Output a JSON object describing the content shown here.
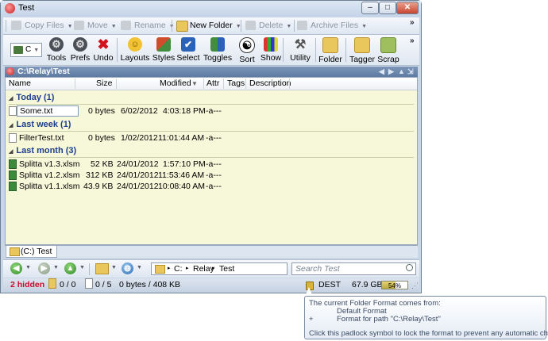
{
  "window": {
    "title": "Test"
  },
  "toolbar1": {
    "copy_files": "Copy Files",
    "move": "Move",
    "rename": "Rename",
    "new_folder": "New Folder",
    "delete": "Delete",
    "archive_files": "Archive Files",
    "overflow": "»"
  },
  "toolbar2": {
    "drive": "C",
    "tools": "Tools",
    "prefs": "Prefs",
    "undo": "Undo",
    "layouts": "Layouts",
    "styles": "Styles",
    "select": "Select",
    "toggles": "Toggles",
    "sort": "Sort",
    "show": "Show",
    "utility": "Utility",
    "folder": "Folder",
    "tagger": "Tagger",
    "scrap": "Scrap",
    "overflow": "»"
  },
  "path": {
    "current": "C:\\Relay\\Test"
  },
  "columns": {
    "name": "Name",
    "size": "Size",
    "modified": "Modified",
    "attr": "Attr",
    "tags": "Tags",
    "description": "Description"
  },
  "groups": [
    {
      "label": "Today (1)",
      "files": [
        {
          "name": "Some.txt",
          "size": "0 bytes",
          "date": "6/02/2012",
          "time": "4:03:18 PM",
          "attr": "-a---"
        }
      ]
    },
    {
      "label": "Last week (1)",
      "files": [
        {
          "name": "FilterTest.txt",
          "size": "0 bytes",
          "date": "1/02/2012",
          "time": "11:01:44 AM",
          "attr": "-a---"
        }
      ]
    },
    {
      "label": "Last month (3)",
      "files": [
        {
          "name": "Splitta v1.3.xlsm",
          "size": "52 KB",
          "date": "24/01/2012",
          "time": "1:57:10 PM",
          "attr": "-a---"
        },
        {
          "name": "Splitta v1.2.xlsm",
          "size": "312 KB",
          "date": "24/01/2012",
          "time": "11:53:46 AM",
          "attr": "-a---"
        },
        {
          "name": "Splitta v1.1.xlsm",
          "size": "43.9 KB",
          "date": "24/01/2012",
          "time": "10:08:40 AM",
          "attr": "-a---"
        }
      ]
    }
  ],
  "tab": {
    "label": "(C:) Test"
  },
  "addressbar": {
    "seg1": "C:",
    "seg2": "Relay",
    "seg3": "Test",
    "sep": "▸"
  },
  "search": {
    "placeholder": "Search Test"
  },
  "status": {
    "hidden": "2 hidden",
    "folders": "0 / 0",
    "files": "0 / 5",
    "bytes": "0 bytes / 408 KB",
    "dest": "DEST",
    "free": "67.9 GB",
    "used_percent_label": "54%",
    "used_fraction": 0.54
  },
  "tooltip": {
    "line1": "The current Folder Format comes from:",
    "line2": "Default Format",
    "line3_prefix": "+",
    "line3": "Format for path \"C:\\Relay\\Test\"",
    "line4": "Click this padlock symbol to lock the format to prevent any automatic changes."
  }
}
